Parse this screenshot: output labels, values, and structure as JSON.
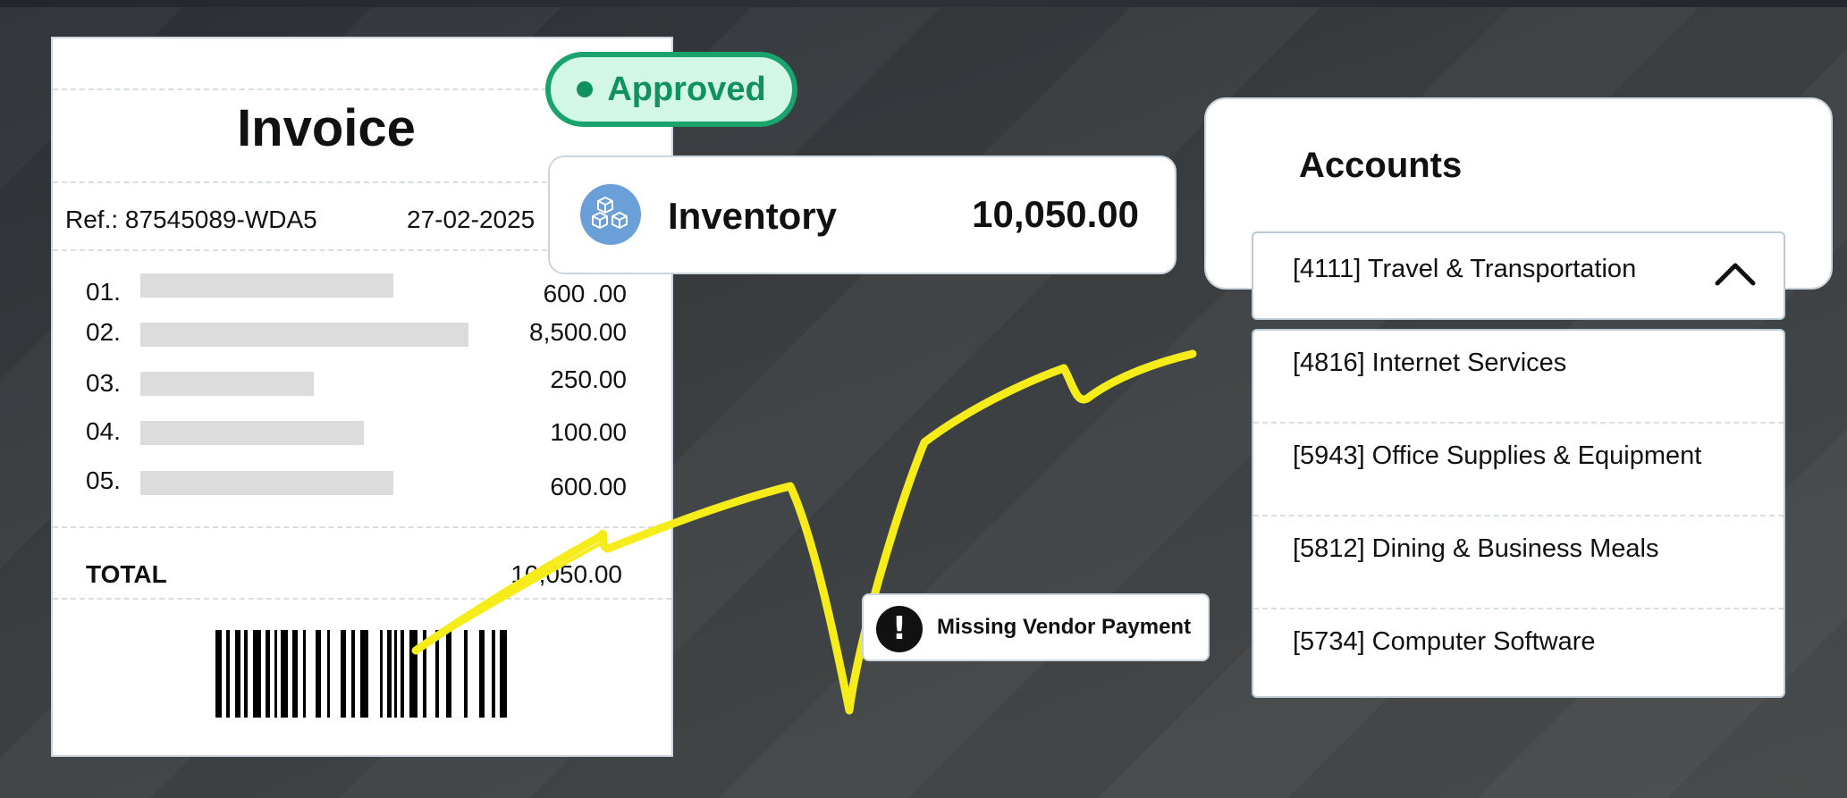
{
  "invoice": {
    "title": "Invoice",
    "ref": "Ref.: 87545089-WDA5",
    "date": "27-02-2025",
    "lines": [
      {
        "num": "01.",
        "amount": "600 .00"
      },
      {
        "num": "02.",
        "amount": "8,500.00"
      },
      {
        "num": "03.",
        "amount": "250.00"
      },
      {
        "num": "04.",
        "amount": "100.00"
      },
      {
        "num": "05.",
        "amount": "600.00"
      }
    ],
    "total_label": "TOTAL",
    "total_amount": "10,050.00"
  },
  "status": {
    "label": "Approved",
    "color": "#1aa36c"
  },
  "inventory": {
    "label": "Inventory",
    "amount": "10,050.00",
    "icon": "boxes-icon"
  },
  "accounts": {
    "title": "Accounts",
    "selected": "[4111] Travel & Transportation",
    "options": [
      "[4816] Internet Services",
      "[5943] Office Supplies & Equipment",
      "[5812] Dining & Business Meals",
      "[5734] Computer Software"
    ]
  },
  "alert": {
    "text": "Missing Vendor Payment",
    "icon": "exclamation-icon"
  },
  "colors": {
    "scribble": "#f5ec1a",
    "accent_blue": "#6a9fd8"
  }
}
